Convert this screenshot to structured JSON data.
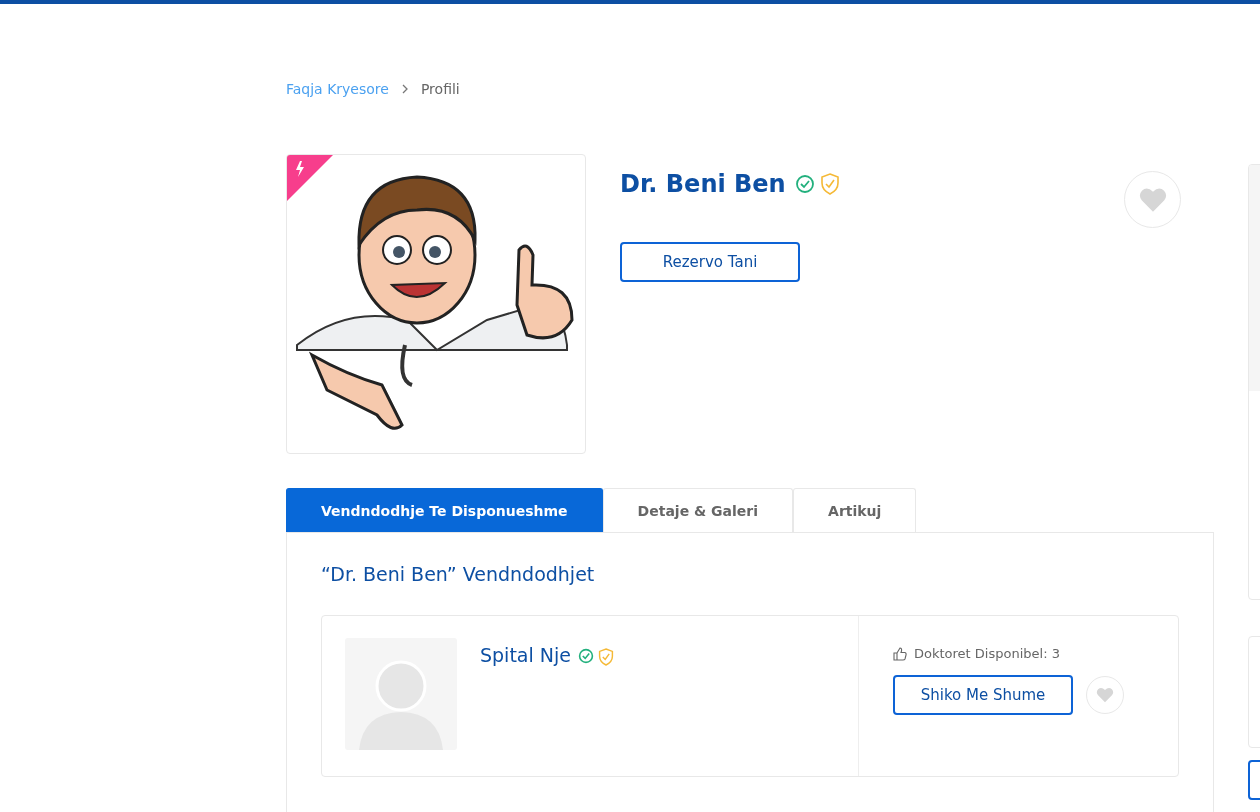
{
  "breadcrumb": [
    {
      "label": "Faqja Kryesore",
      "link": true
    },
    {
      "label": "Profili",
      "link": false
    }
  ],
  "profile": {
    "name": "Dr. Beni Ben",
    "book_button": "Rezervo Tani"
  },
  "tabs": [
    {
      "label": "Vendndodhje Te Disponueshme",
      "selected": true
    },
    {
      "label": "Detaje & Galeri",
      "selected": false
    },
    {
      "label": "Artikuj",
      "selected": false
    }
  ],
  "locations_heading": "“Dr. Beni Ben” Vendndodhjet",
  "locations": [
    {
      "name": "Spital Nje",
      "availability": "Doktoret Disponibel: 3",
      "button": "Shiko Me Shume"
    }
  ]
}
